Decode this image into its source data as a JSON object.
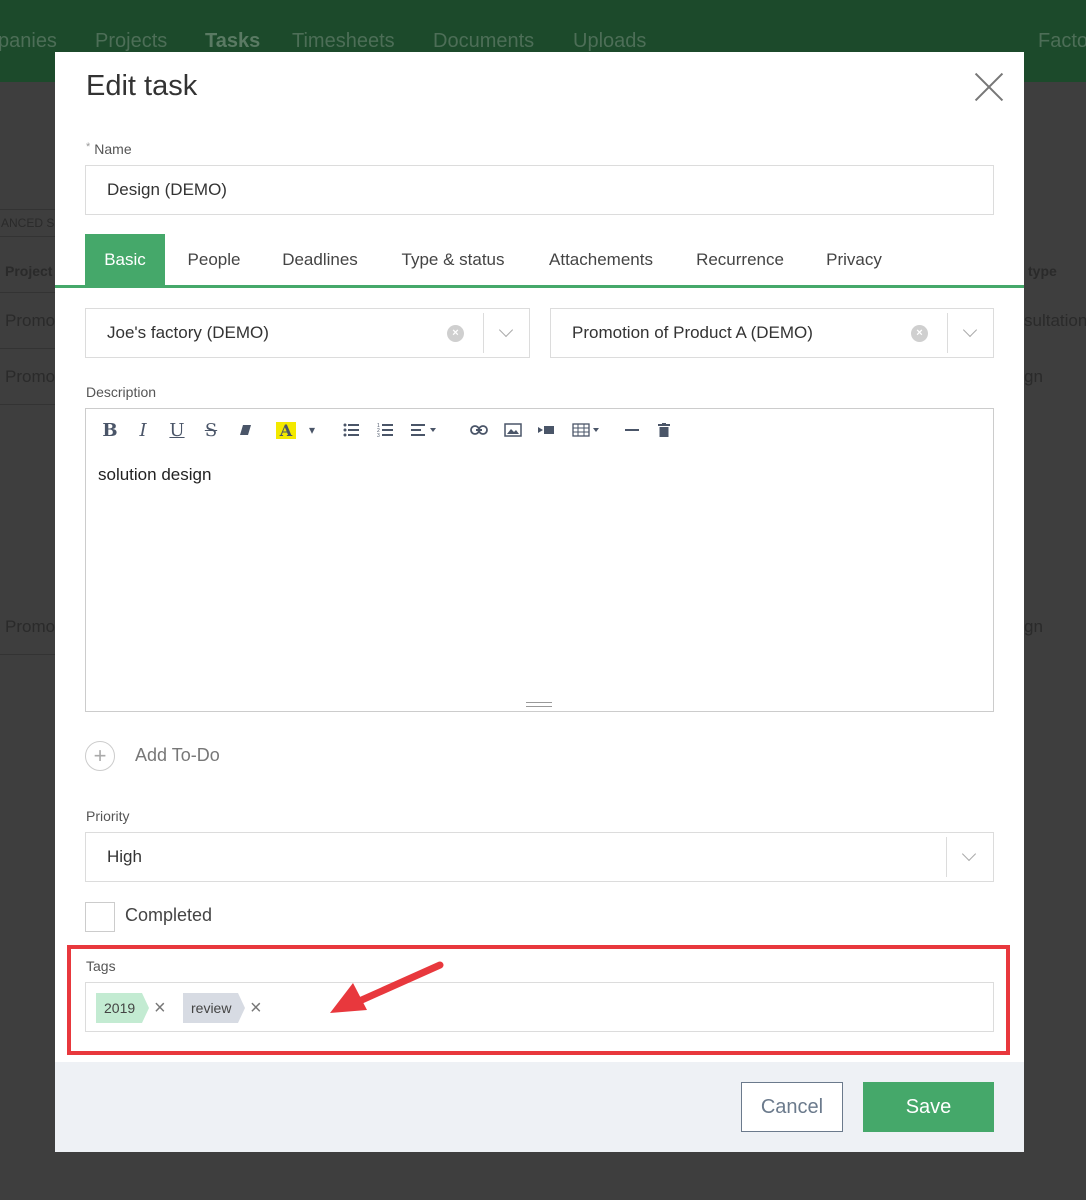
{
  "background": {
    "nav_items": [
      "panies",
      "Projects",
      "Tasks",
      "Timesheets",
      "Documents",
      "Uploads",
      "Facto"
    ],
    "advanced_search": "ANCED SE",
    "col_project": "Project",
    "col_type": "type",
    "row_project": "Promo",
    "row_types": [
      "sultation",
      "gn",
      "gn"
    ]
  },
  "modal": {
    "title": "Edit task",
    "name_label": "Name",
    "name_required_mark": "*",
    "name_value": "Design (DEMO)",
    "tabs": [
      "Basic",
      "People",
      "Deadlines",
      "Type & status",
      "Attachements",
      "Recurrence",
      "Privacy"
    ],
    "active_tab": "Basic",
    "company_value": "Joe's factory (DEMO)",
    "project_value": "Promotion of Product A (DEMO)",
    "description_label": "Description",
    "description_text": "solution design",
    "toolbar": {
      "bold": "B",
      "italic": "I",
      "underline": "U",
      "strike": "S",
      "highlight": "A",
      "caret": "▾"
    },
    "add_todo_label": "Add To-Do",
    "add_todo_icon": "+",
    "priority_label": "Priority",
    "priority_value": "High",
    "completed_label": "Completed",
    "tags_label": "Tags",
    "tags": [
      {
        "label": "2019",
        "color": "#c3ebd2"
      },
      {
        "label": "review",
        "color": "#d7dbe3"
      }
    ],
    "tag_remove_glyph": "×",
    "cancel_label": "Cancel",
    "save_label": "Save"
  },
  "colors": {
    "accent": "#45a86a",
    "highlight_box": "#e8383d",
    "footer_bg": "#eef1f5"
  }
}
